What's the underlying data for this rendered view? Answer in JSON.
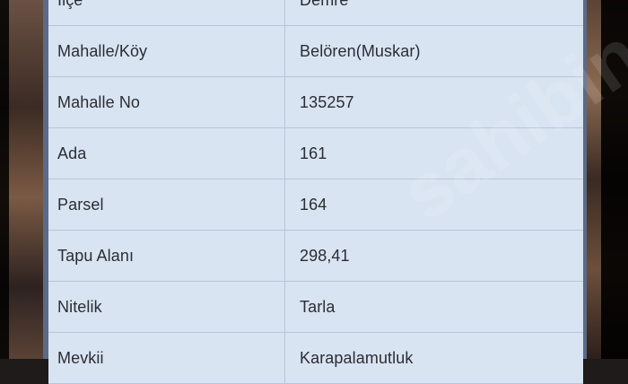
{
  "rows": [
    {
      "label": "İlçe",
      "value": "Demre"
    },
    {
      "label": "Mahalle/Köy",
      "value": "Belören(Muskar)"
    },
    {
      "label": "Mahalle No",
      "value": "135257"
    },
    {
      "label": "Ada",
      "value": "161"
    },
    {
      "label": "Parsel",
      "value": "164"
    },
    {
      "label": "Tapu Alanı",
      "value": "298,41"
    },
    {
      "label": "Nitelik",
      "value": "Tarla"
    },
    {
      "label": "Mevkii",
      "value": "Karapalamutluk"
    }
  ],
  "watermark": "sahibinden.com",
  "colors": {
    "row_bg": "#d9e4f2",
    "frame": "#5b6a86",
    "text": "#2a2d33"
  }
}
